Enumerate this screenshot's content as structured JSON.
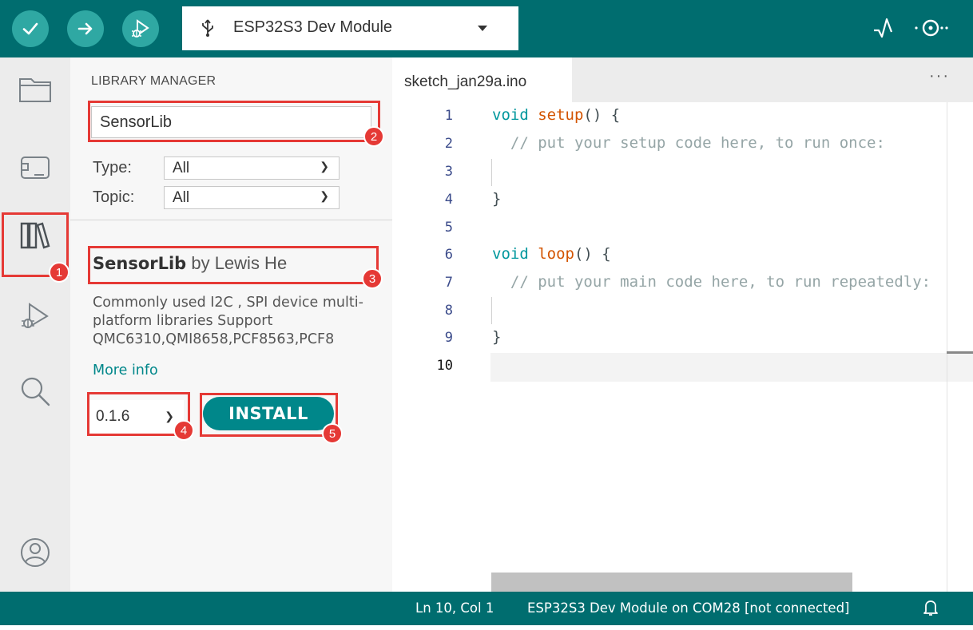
{
  "toolbar": {
    "verify": {
      "icon": "check-icon"
    },
    "upload": {
      "icon": "arrow-right-icon"
    },
    "debug": {
      "icon": "debug-icon"
    },
    "board_select": {
      "icon": "usb-icon",
      "label": "ESP32S3 Dev Module"
    },
    "serial_plotter": {
      "icon": "serial-plotter-icon"
    },
    "serial_monitor": {
      "icon": "serial-monitor-icon"
    }
  },
  "sidebar": {
    "items": [
      {
        "name": "sketchbook",
        "icon": "folder-icon"
      },
      {
        "name": "boards-manager",
        "icon": "board-icon"
      },
      {
        "name": "library-manager",
        "icon": "library-icon"
      },
      {
        "name": "debug",
        "icon": "debug-icon"
      },
      {
        "name": "search",
        "icon": "search-icon"
      },
      {
        "name": "profile",
        "icon": "user-icon"
      }
    ]
  },
  "library_panel": {
    "title": "LIBRARY MANAGER",
    "search_value": "SensorLib",
    "type_label": "Type:",
    "type_value": "All",
    "topic_label": "Topic:",
    "topic_value": "All",
    "result": {
      "name": "SensorLib",
      "author": "by Lewis He",
      "description": "Commonly used I2C , SPI device multi-platform libraries Support QMC6310,QMI8658,PCF8563,PCF8",
      "more_info": "More info",
      "version": "0.1.6",
      "install_label": "INSTALL"
    }
  },
  "editor": {
    "tab_name": "sketch_jan29a.ino",
    "more_label": "···",
    "line_numbers": [
      "1",
      "2",
      "3",
      "4",
      "5",
      "6",
      "7",
      "8",
      "9",
      "10"
    ],
    "code": {
      "l1_kw": "void",
      "l1_fn": "setup",
      "l1_rest": "() {",
      "l2_cm": "// put your setup code here, to run once:",
      "l4": "}",
      "l6_kw": "void",
      "l6_fn": "loop",
      "l6_rest": "() {",
      "l7_cm": "// put your main code here, to run repeatedly:",
      "l9": "}"
    }
  },
  "statusbar": {
    "position": "Ln 10, Col 1",
    "board_status": "ESP32S3 Dev Module on COM28 [not connected]",
    "bell_icon": "bell-icon"
  },
  "annotations": [
    "1",
    "2",
    "3",
    "4",
    "5"
  ],
  "colors": {
    "toolbar": "#006d6f",
    "button": "#2fa8a3",
    "accent": "#00878a",
    "callout": "#e53935"
  }
}
